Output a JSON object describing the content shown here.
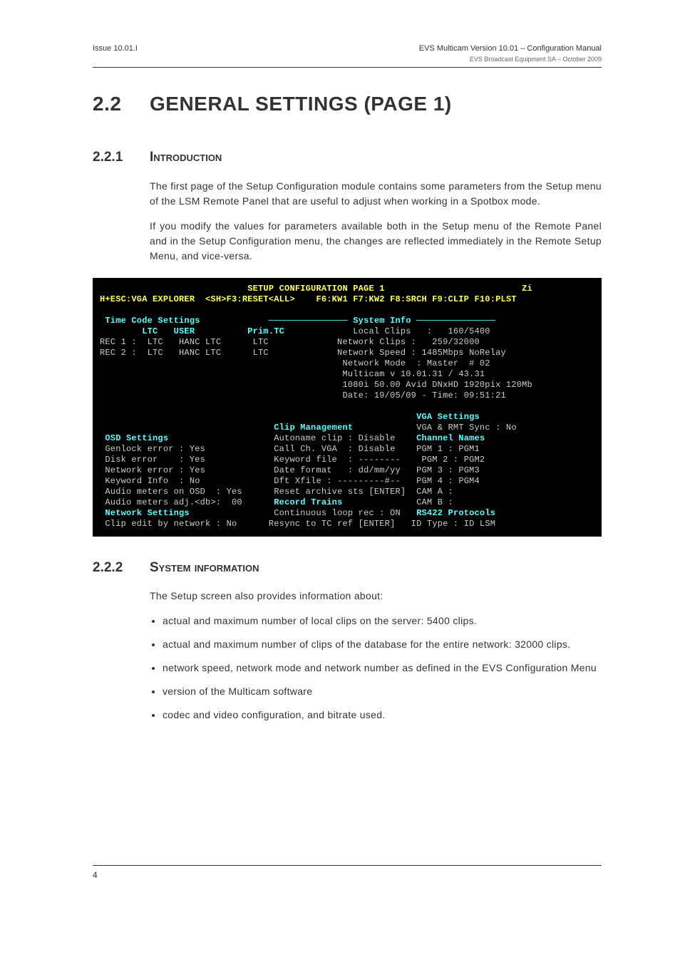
{
  "header": {
    "left": "Issue 10.01.I",
    "right_main": "EVS Multicam Version 10.01 – Configuration Manual",
    "right_sub": "EVS Broadcast Equipment SA – October 2009"
  },
  "title": {
    "num": "2.2",
    "text": "GENERAL SETTINGS (PAGE 1)"
  },
  "intro": {
    "num": "2.2.1",
    "heading": "Introduction",
    "p1": "The first page of the Setup Configuration module contains some parameters from the Setup menu of the LSM Remote Panel that are useful to adjust when working in a Spotbox mode.",
    "p2": "If you modify the values for parameters available both in the Setup menu of the Remote Panel and in the Setup Configuration menu, the changes are reflected immediately in the Remote Setup Menu, and vice-versa."
  },
  "terminal": {
    "title_line_left": "                            SETUP CONFIGURATION PAGE 1",
    "title_line_right": "Zi",
    "nav_left": "H+ESC:VGA EXPLORER  <SH>F3:RESET<ALL>",
    "nav_right": "F6:KW1 F7:KW2 F8:SRCH F9:CLIP F10:PLST",
    "tc_heading": " Time Code Settings",
    "tc_cols": "        LTC   USER          Prim.TC",
    "tc_r1": "REC 1 :  LTC   HANC LTC      LTC",
    "tc_r2": "REC 2 :  LTC   HANC LTC      LTC",
    "sys_heading_pre": "             ─────────────── ",
    "sys_heading": "System Info",
    "sys_heading_post": " ───────────────",
    "sys_l1": "             Local Clips   :   160/5400",
    "sys_l2": "             Network Clips :   259/32000",
    "sys_l3": "             Network Speed : 1485Mbps NoRelay",
    "sys_l4": "             Network Mode  : Master  # 02",
    "sys_l5": "             Multicam v 10.01.31 / 43.31",
    "sys_l6": "             1080i 50.00 Avid DNxHD 1920pix 120Mb",
    "sys_l7": "             Date: 19/05/09 - Time: 09:51:21",
    "vga_heading": "VGA Settings",
    "vga_l1": "VGA & RMT Sync : No",
    "clip_heading": "Clip Management",
    "osd_heading": " OSD Settings",
    "osd_l1": " Genlock error : Yes",
    "osd_l2": " Disk error    : Yes",
    "osd_l3": " Network error : Yes",
    "osd_l4": " Keyword Info  : No",
    "osd_l5": " Audio meters on OSD  : Yes",
    "osd_l6": " Audio meters adj.<db>:  00",
    "clip_l1": "Autoname clip : Disable",
    "clip_l2": "Call Ch. VGA  : Disable",
    "clip_l3": "Keyword file  : --------",
    "clip_l4": "Date format   : dd/mm/yy",
    "clip_l5": "Dft Xfile : ---------#--",
    "clip_l6": "Reset archive sts [ENTER]",
    "chan_heading": "Channel Names",
    "chan_l1": "PGM 1 : PGM1",
    "chan_l2": "PGM 2 : PGM2",
    "chan_l3": "PGM 3 : PGM3",
    "chan_l4": "PGM 4 : PGM4",
    "chan_l5": "CAM A :",
    "chan_l6": "CAM B :",
    "rec_heading": "Record Trains",
    "net_heading": " Network Settings",
    "net_l1": " Clip edit by network : No",
    "rec_l1": "Continuous loop rec : ON",
    "rec_l2": "Resync to TC ref [ENTER]",
    "rs_heading": "RS422 Protocols",
    "rs_l1": "ID Type : ID LSM"
  },
  "sysinfo": {
    "num": "2.2.2",
    "heading": "System information",
    "intro": "The Setup screen also provides information about:",
    "b1": "actual and maximum number of local clips on the server: 5400 clips.",
    "b2": "actual and maximum number of clips of the database for the entire network: 32000 clips.",
    "b3": "network speed, network mode and network number as defined in the EVS Configuration Menu",
    "b4": "version of the Multicam software",
    "b5": "codec and video configuration, and bitrate used."
  },
  "page_num": "4"
}
